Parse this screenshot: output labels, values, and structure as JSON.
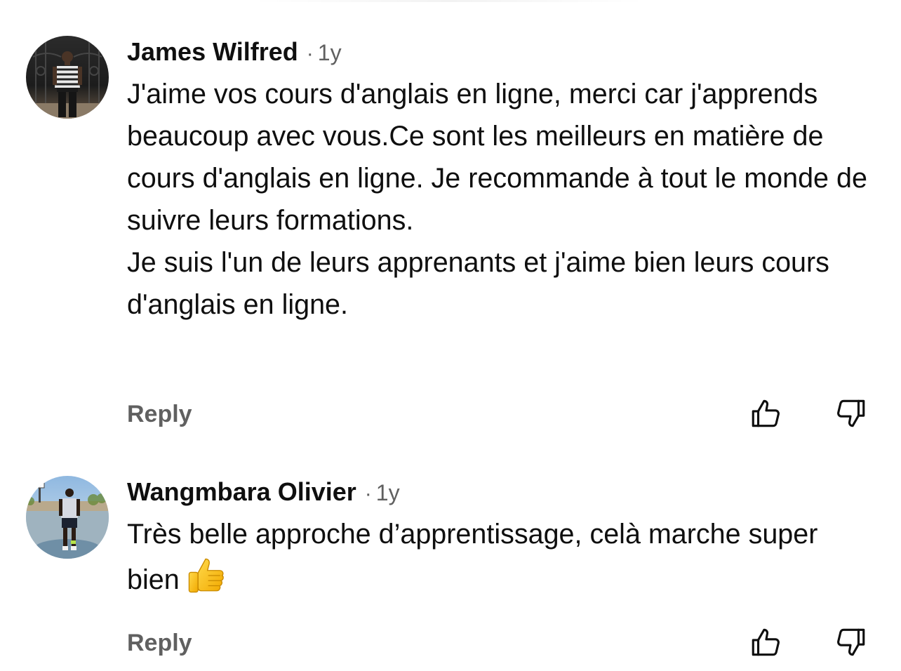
{
  "comments": [
    {
      "author": "James Wilfred",
      "separator": "·",
      "time": "1y",
      "text": "J'aime vos cours d'anglais en ligne, merci car j'apprends beaucoup avec vous.Ce sont les meilleurs en matière de cours d'anglais en ligne. Je recommande à tout le monde de suivre leurs formations.\nJe suis l'un de leurs apprenants et j'aime bien leurs cours d'anglais en ligne.",
      "reply_label": "Reply",
      "like_icon": "thumbs-up-icon",
      "dislike_icon": "thumbs-down-icon"
    },
    {
      "author": "Wangmbara Olivier",
      "separator": "·",
      "time": "1y",
      "text": "Très belle approche d’apprentissage, celà marche super bien",
      "emoji": "thumbs-up-emoji",
      "reply_label": "Reply",
      "like_icon": "thumbs-up-icon",
      "dislike_icon": "thumbs-down-icon"
    }
  ],
  "colors": {
    "primary_text": "#0f0f0f",
    "secondary_text": "#606060",
    "background": "#ffffff"
  }
}
